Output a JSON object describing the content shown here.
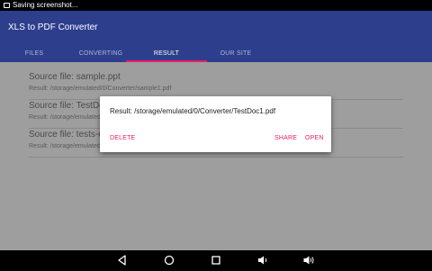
{
  "status_bar": {
    "notification": "Saving screenshot..."
  },
  "toolbar": {
    "title": "XLS to PDF Converter"
  },
  "tabs": [
    {
      "label": "FILES"
    },
    {
      "label": "CONVERTING"
    },
    {
      "label": "RESULT"
    },
    {
      "label": "OUR SITE"
    }
  ],
  "active_tab": "RESULT",
  "entries": [
    {
      "source": "Source file: sample.ppt",
      "result": "Result: /storage/emulated/0/Converter/sample1.pdf"
    },
    {
      "source": "Source file: TestDoc.doc",
      "result": "Result: /storage/emulated/0/Converter/TestDoc1.pdf"
    },
    {
      "source": "Source file: tests-example.xls",
      "result": "Result: /storage/emulated/0/Converter/tests-example1.pdf"
    }
  ],
  "dialog": {
    "message": "Result: /storage/emulated/0/Converter/TestDoc1.pdf",
    "delete_label": "DELETE",
    "share_label": "SHARE",
    "open_label": "OPEN"
  },
  "colors": {
    "toolbar": "#2d3e8c",
    "accent": "#e91e63",
    "scrim": "#9e9e9e"
  },
  "nav_bar": {
    "icons": [
      "back-icon",
      "home-icon",
      "recents-icon",
      "volume-down-icon",
      "volume-up-icon"
    ]
  }
}
